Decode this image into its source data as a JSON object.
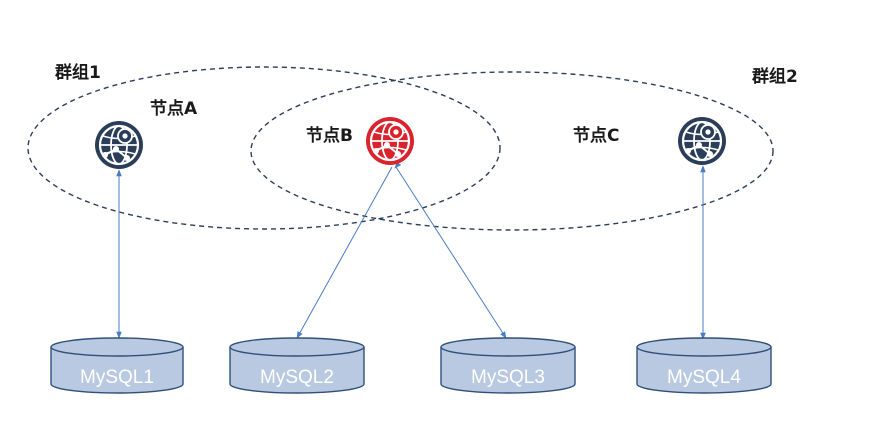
{
  "groups": [
    {
      "id": "group-1",
      "label": "群组1"
    },
    {
      "id": "group-2",
      "label": "群组2"
    }
  ],
  "nodes": [
    {
      "id": "node-a",
      "label": "节点A",
      "icon": "globe-network-icon",
      "color": "#2b3e59"
    },
    {
      "id": "node-b",
      "label": "节点B",
      "icon": "globe-network-icon",
      "color": "#d9232d"
    },
    {
      "id": "node-c",
      "label": "节点C",
      "icon": "globe-network-icon",
      "color": "#2b3e59"
    }
  ],
  "databases": [
    {
      "id": "mysql-1",
      "label": "MySQL1"
    },
    {
      "id": "mysql-2",
      "label": "MySQL2"
    },
    {
      "id": "mysql-3",
      "label": "MySQL3"
    },
    {
      "id": "mysql-4",
      "label": "MySQL4"
    }
  ],
  "connections": [
    {
      "from": "node-a",
      "to": "mysql-1"
    },
    {
      "from": "node-b",
      "to": "mysql-2"
    },
    {
      "from": "node-b",
      "to": "mysql-3"
    },
    {
      "from": "node-c",
      "to": "mysql-4"
    }
  ],
  "colors": {
    "ellipse": "#2b3e59",
    "arrow": "#4a7cc4",
    "db_fill": "#b8c9e1",
    "db_stroke": "#2f4f7a"
  }
}
